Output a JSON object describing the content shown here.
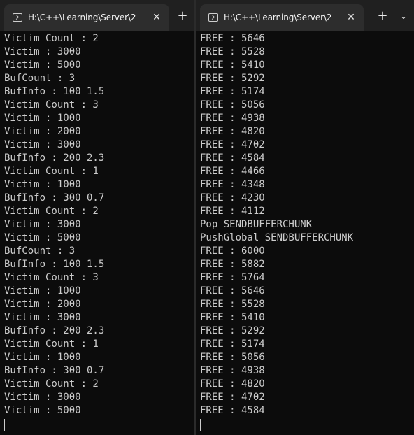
{
  "panes": {
    "left": {
      "tab_title": "H:\\C++\\Learning\\Server\\2",
      "tab_close": "✕",
      "new_tab": "+",
      "lines": [
        "Victim Count : 2",
        "Victim : 3000",
        "Victim : 5000",
        "BufCount : 3",
        "BufInfo : 100 1.5",
        "Victim Count : 3",
        "Victim : 1000",
        "Victim : 2000",
        "Victim : 3000",
        "BufInfo : 200 2.3",
        "Victim Count : 1",
        "Victim : 1000",
        "BufInfo : 300 0.7",
        "Victim Count : 2",
        "Victim : 3000",
        "Victim : 5000",
        "BufCount : 3",
        "BufInfo : 100 1.5",
        "Victim Count : 3",
        "Victim : 1000",
        "Victim : 2000",
        "Victim : 3000",
        "BufInfo : 200 2.3",
        "Victim Count : 1",
        "Victim : 1000",
        "BufInfo : 300 0.7",
        "Victim Count : 2",
        "Victim : 3000",
        "Victim : 5000"
      ]
    },
    "right": {
      "tab_title": "H:\\C++\\Learning\\Server\\2",
      "tab_close": "✕",
      "new_tab": "+",
      "dropdown": "⌄",
      "lines": [
        "FREE : 5646",
        "FREE : 5528",
        "FREE : 5410",
        "FREE : 5292",
        "FREE : 5174",
        "FREE : 5056",
        "FREE : 4938",
        "FREE : 4820",
        "FREE : 4702",
        "FREE : 4584",
        "FREE : 4466",
        "FREE : 4348",
        "FREE : 4230",
        "FREE : 4112",
        "Pop SENDBUFFERCHUNK",
        "PushGlobal SENDBUFFERCHUNK",
        "FREE : 6000",
        "FREE : 5882",
        "FREE : 5764",
        "FREE : 5646",
        "FREE : 5528",
        "FREE : 5410",
        "FREE : 5292",
        "FREE : 5174",
        "FREE : 5056",
        "FREE : 4938",
        "FREE : 4820",
        "FREE : 4702",
        "FREE : 4584"
      ]
    }
  }
}
